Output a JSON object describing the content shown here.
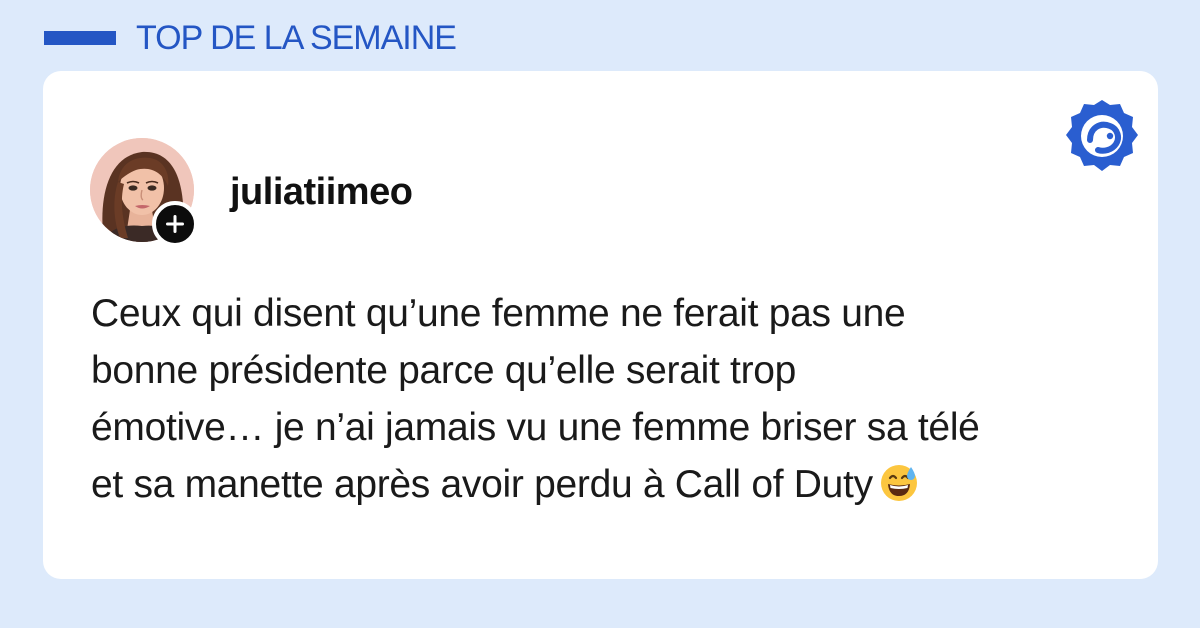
{
  "header": {
    "label": "TOP DE LA SEMAINE"
  },
  "post": {
    "username": "juliatiimeo",
    "text": "Ceux qui disent qu’une femme ne ferait pas une\nbonne présidente parce qu’elle serait trop\némotive… je n’ai jamais vu une femme briser sa télé\net sa manette après avoir perdu à Call of Duty",
    "emoji": "grinning-sweat-emoji"
  },
  "icons": {
    "follow": "plus-icon",
    "brand": "brand-logo-icon"
  },
  "colors": {
    "background": "#ddeafb",
    "accent": "#2456c4",
    "card": "#ffffff",
    "text": "#1a1a1a"
  }
}
